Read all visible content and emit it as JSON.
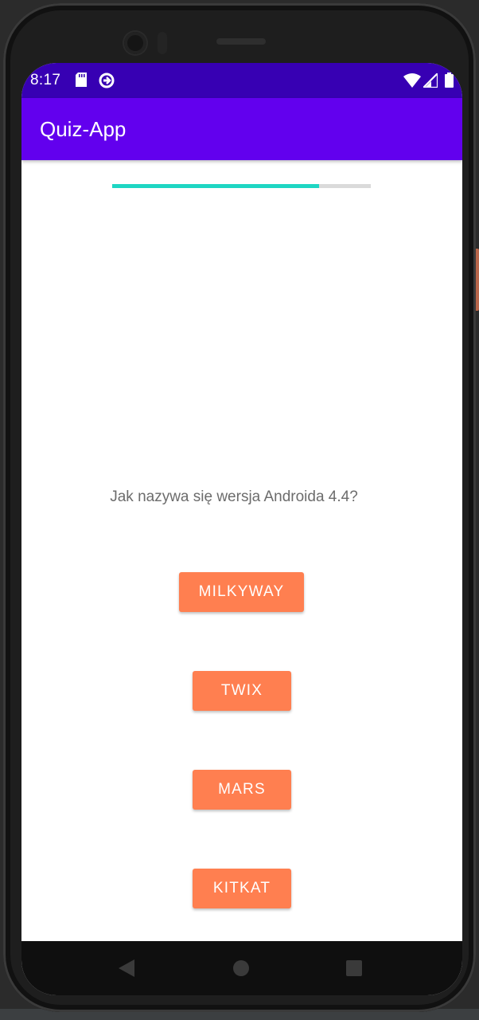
{
  "status_bar": {
    "time": "8:17",
    "icons": [
      "sd-card-icon",
      "sync-icon",
      "wifi-icon",
      "signal-icon",
      "battery-icon"
    ],
    "color": "#3700b3"
  },
  "app_bar": {
    "title": "Quiz-App",
    "color": "#6200ee"
  },
  "progress": {
    "value_percent": 80,
    "fill_color": "#1ed6c3",
    "track_color": "#dadada"
  },
  "question": {
    "text": "Jak nazywa się wersja Androida 4.4?"
  },
  "answers": [
    {
      "label": "MILKYWAY"
    },
    {
      "label": "TWIX"
    },
    {
      "label": "MARS"
    },
    {
      "label": "KITKAT"
    }
  ],
  "answer_button_color": "#ff7f50",
  "nav_bar": {
    "buttons": [
      "back-icon",
      "home-icon",
      "recents-icon"
    ]
  }
}
